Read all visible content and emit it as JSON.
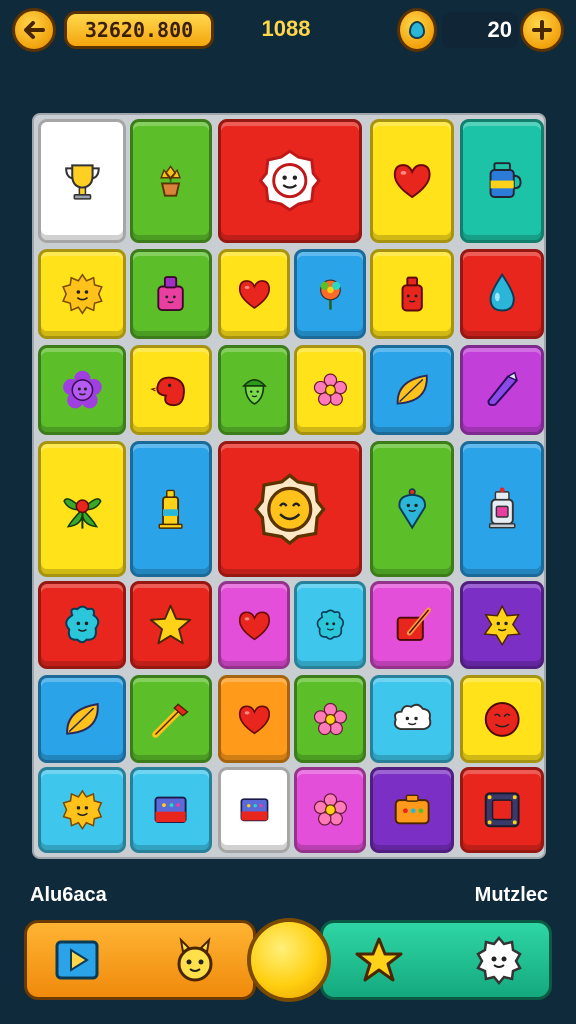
{
  "header": {
    "back_icon": "arrow-left-icon",
    "score": "32620.800",
    "moves": "1088",
    "gem_icon": "water-drop-icon",
    "coins": "20",
    "plus_icon": "plus-icon"
  },
  "board": {
    "tiles": [
      {
        "id": "trophy",
        "color": "#ffffff",
        "icon": "trophy-icon"
      },
      {
        "id": "flower-pot",
        "color": "#5cbf2a",
        "icon": "flower-pot-icon"
      },
      {
        "id": "face-badge",
        "color": "#e8261e",
        "icon": "face-badge-icon"
      },
      {
        "id": "heart",
        "color": "#ffe21a",
        "icon": "heart-icon"
      },
      {
        "id": "jar",
        "color": "#1dc3a6",
        "icon": "jar-icon"
      },
      {
        "id": "sun-face",
        "color": "#ffe21a",
        "icon": "sun-face-icon"
      },
      {
        "id": "bag",
        "color": "#5cbf2a",
        "icon": "bag-icon"
      },
      {
        "id": "heart",
        "color": "#ffe21a",
        "icon": "heart-icon"
      },
      {
        "id": "tree-flower",
        "color": "#2ba3e8",
        "icon": "tree-flower-icon"
      },
      {
        "id": "bottle",
        "color": "#ffe21a",
        "icon": "bottle-icon"
      },
      {
        "id": "drop",
        "color": "#e8261e",
        "icon": "drop-icon"
      },
      {
        "id": "blob-flower",
        "color": "#5cbf2a",
        "icon": "blob-flower-icon"
      },
      {
        "id": "bird",
        "color": "#ffe21a",
        "icon": "bird-icon"
      },
      {
        "id": "acorn",
        "color": "#5cbf2a",
        "icon": "acorn-icon"
      },
      {
        "id": "pink-flower",
        "color": "#ffe21a",
        "icon": "pink-flower-icon"
      },
      {
        "id": "leaf",
        "color": "#2ba3e8",
        "icon": "leaf-icon"
      },
      {
        "id": "crystal",
        "color": "#c23fd9",
        "icon": "crystal-icon"
      },
      {
        "id": "berry-plant",
        "color": "#ffe21a",
        "icon": "berry-plant-icon"
      },
      {
        "id": "tower",
        "color": "#2ba3e8",
        "icon": "tower-icon"
      },
      {
        "id": "smile-badge",
        "color": "#e8261e",
        "icon": "smile-badge-icon"
      },
      {
        "id": "pin",
        "color": "#5cbf2a",
        "icon": "pin-icon"
      },
      {
        "id": "lantern",
        "color": "#2ba3e8",
        "icon": "lantern-icon"
      },
      {
        "id": "teal-blob",
        "color": "#e8261e",
        "icon": "blob-face-icon"
      },
      {
        "id": "star",
        "color": "#e8261e",
        "icon": "star-icon"
      },
      {
        "id": "heart",
        "color": "#e34fd8",
        "icon": "heart-icon"
      },
      {
        "id": "purple-blob",
        "color": "#3ec6ec",
        "icon": "blob-face-icon"
      },
      {
        "id": "kit",
        "color": "#e34fd8",
        "icon": "kit-icon"
      },
      {
        "id": "star-face",
        "color": "#7b2fc4",
        "icon": "star-face-icon"
      },
      {
        "id": "leaf-orange",
        "color": "#2ba3e8",
        "icon": "leaf-icon"
      },
      {
        "id": "wand",
        "color": "#5cbf2a",
        "icon": "wand-icon"
      },
      {
        "id": "heart-flower",
        "color": "#ff9a1a",
        "icon": "heart-icon"
      },
      {
        "id": "red-flower",
        "color": "#5cbf2a",
        "icon": "pink-flower-icon"
      },
      {
        "id": "cloud-face",
        "color": "#3ec6ec",
        "icon": "cloud-face-icon"
      },
      {
        "id": "red-face",
        "color": "#ffe21a",
        "icon": "red-face-icon"
      },
      {
        "id": "sun-face2",
        "color": "#3ec6ec",
        "icon": "sun-face-icon"
      },
      {
        "id": "box",
        "color": "#3ec6ec",
        "icon": "box-icon"
      },
      {
        "id": "green-box",
        "color": "#ffffff",
        "icon": "box-icon"
      },
      {
        "id": "flower",
        "color": "#e34fd8",
        "icon": "pink-flower-icon"
      },
      {
        "id": "camera",
        "color": "#7b2fc4",
        "icon": "camera-icon"
      },
      {
        "id": "frame",
        "color": "#e8261e",
        "icon": "frame-icon"
      }
    ]
  },
  "footer": {
    "left_label": "Alu6aca",
    "right_label": "Mutzlec",
    "play_icon": "play-icon",
    "creature_icon": "creature-icon",
    "coin_icon": "coin-icon",
    "star_icon": "star-icon",
    "badge_icon": "badge-face-icon"
  }
}
